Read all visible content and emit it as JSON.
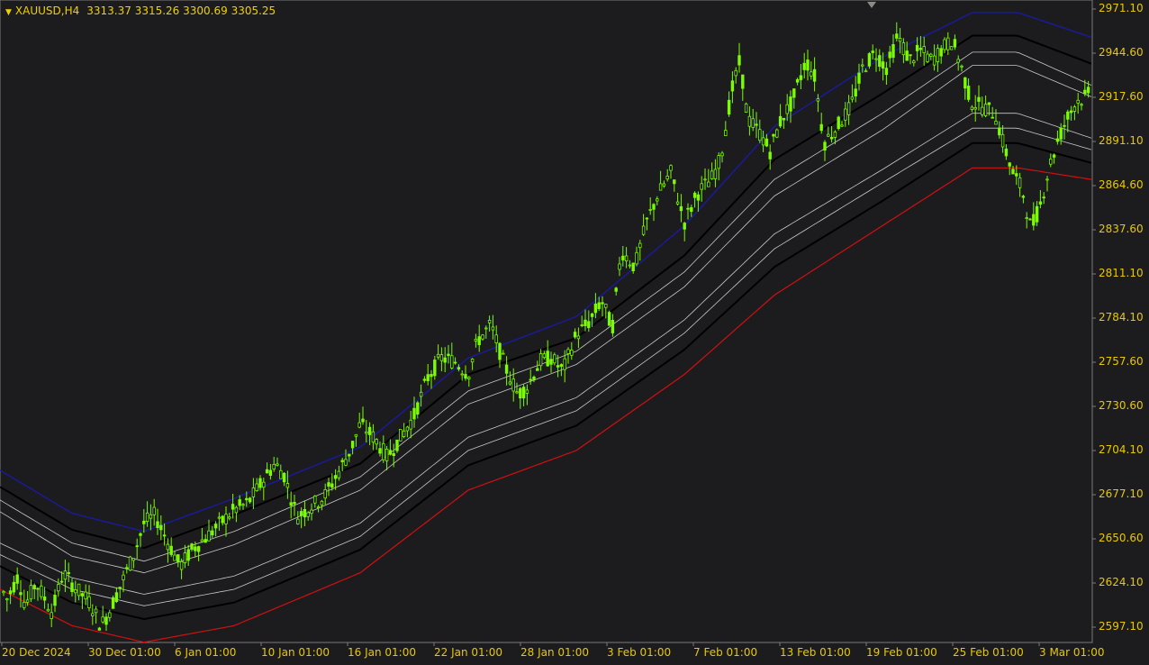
{
  "header": {
    "symbol": "XAUUSD,H4",
    "quote": "3313.37 3315.26 3300.69 3305.25"
  },
  "colors": {
    "background": "#1c1c1e",
    "axis": "#e8c800",
    "bull_candle": "#7cfc00",
    "upper_band": "#1a1aa0",
    "lower_band": "#d01010",
    "inner_dark": "#000000",
    "inner_light": "#c8c8c8"
  },
  "y_axis": {
    "ticks": [
      "2971.10",
      "2944.60",
      "2917.60",
      "2891.10",
      "2864.60",
      "2837.60",
      "2811.10",
      "2784.10",
      "2757.60",
      "2730.60",
      "2704.10",
      "2677.10",
      "2650.60",
      "2624.10",
      "2597.10"
    ]
  },
  "x_axis": {
    "ticks": [
      "20 Dec 2024",
      "30 Dec 01:00",
      "6 Jan 01:00",
      "10 Jan 01:00",
      "16 Jan 01:00",
      "22 Jan 01:00",
      "28 Jan 01:00",
      "3 Feb 01:00",
      "7 Feb 01:00",
      "13 Feb 01:00",
      "19 Feb 01:00",
      "25 Feb 01:00",
      "3 Mar 01:00"
    ]
  },
  "chart_data": {
    "type": "candlestick",
    "symbol": "XAUUSD",
    "timeframe": "H4",
    "ylim": [
      2590,
      2975
    ],
    "price_path": [
      [
        0,
        2622
      ],
      [
        8,
        2614
      ],
      [
        20,
        2628
      ],
      [
        28,
        2610
      ],
      [
        40,
        2624
      ],
      [
        58,
        2606
      ],
      [
        70,
        2630
      ],
      [
        85,
        2620
      ],
      [
        100,
        2612
      ],
      [
        112,
        2598
      ],
      [
        120,
        2605
      ],
      [
        132,
        2620
      ],
      [
        148,
        2640
      ],
      [
        160,
        2660
      ],
      [
        172,
        2665
      ],
      [
        185,
        2650
      ],
      [
        200,
        2634
      ],
      [
        215,
        2645
      ],
      [
        230,
        2652
      ],
      [
        245,
        2660
      ],
      [
        260,
        2668
      ],
      [
        275,
        2672
      ],
      [
        290,
        2684
      ],
      [
        305,
        2696
      ],
      [
        315,
        2690
      ],
      [
        330,
        2664
      ],
      [
        345,
        2670
      ],
      [
        360,
        2676
      ],
      [
        375,
        2690
      ],
      [
        390,
        2705
      ],
      [
        400,
        2720
      ],
      [
        415,
        2712
      ],
      [
        430,
        2700
      ],
      [
        445,
        2712
      ],
      [
        460,
        2725
      ],
      [
        475,
        2748
      ],
      [
        490,
        2760
      ],
      [
        505,
        2758
      ],
      [
        520,
        2750
      ],
      [
        530,
        2770
      ],
      [
        545,
        2780
      ],
      [
        560,
        2756
      ],
      [
        575,
        2738
      ],
      [
        585,
        2742
      ],
      [
        600,
        2758
      ],
      [
        612,
        2760
      ],
      [
        625,
        2752
      ],
      [
        640,
        2774
      ],
      [
        655,
        2782
      ],
      [
        668,
        2795
      ],
      [
        680,
        2778
      ],
      [
        690,
        2825
      ],
      [
        705,
        2815
      ],
      [
        718,
        2842
      ],
      [
        730,
        2858
      ],
      [
        745,
        2872
      ],
      [
        760,
        2842
      ],
      [
        775,
        2860
      ],
      [
        790,
        2868
      ],
      [
        800,
        2880
      ],
      [
        812,
        2920
      ],
      [
        822,
        2940
      ],
      [
        830,
        2905
      ],
      [
        845,
        2895
      ],
      [
        855,
        2885
      ],
      [
        868,
        2905
      ],
      [
        880,
        2915
      ],
      [
        895,
        2940
      ],
      [
        905,
        2930
      ],
      [
        915,
        2890
      ],
      [
        930,
        2900
      ],
      [
        945,
        2912
      ],
      [
        958,
        2935
      ],
      [
        972,
        2945
      ],
      [
        985,
        2935
      ],
      [
        997,
        2955
      ],
      [
        1010,
        2940
      ],
      [
        1022,
        2946
      ],
      [
        1035,
        2940
      ],
      [
        1048,
        2948
      ],
      [
        1058,
        2952
      ],
      [
        1068,
        2935
      ],
      [
        1078,
        2915
      ],
      [
        1090,
        2912
      ],
      [
        1105,
        2908
      ],
      [
        1115,
        2888
      ],
      [
        1125,
        2872
      ],
      [
        1135,
        2862
      ],
      [
        1145,
        2838
      ],
      [
        1155,
        2852
      ],
      [
        1165,
        2875
      ],
      [
        1175,
        2892
      ],
      [
        1185,
        2905
      ],
      [
        1195,
        2915
      ],
      [
        1212,
        2920
      ]
    ],
    "bands": {
      "upper": [
        [
          0,
          2692
        ],
        [
          80,
          2666
        ],
        [
          160,
          2655
        ],
        [
          260,
          2675
        ],
        [
          400,
          2706
        ],
        [
          520,
          2760
        ],
        [
          640,
          2785
        ],
        [
          760,
          2840
        ],
        [
          860,
          2900
        ],
        [
          980,
          2942
        ],
        [
          1080,
          2969
        ],
        [
          1130,
          2969
        ],
        [
          1212,
          2954
        ]
      ],
      "inner_top_dark": [
        [
          0,
          2682
        ],
        [
          80,
          2656
        ],
        [
          160,
          2645
        ],
        [
          260,
          2665
        ],
        [
          400,
          2696
        ],
        [
          520,
          2750
        ],
        [
          640,
          2772
        ],
        [
          760,
          2822
        ],
        [
          860,
          2880
        ],
        [
          980,
          2920
        ],
        [
          1080,
          2955
        ],
        [
          1130,
          2955
        ],
        [
          1212,
          2938
        ]
      ],
      "inner_top_light": [
        [
          0,
          2674
        ],
        [
          80,
          2648
        ],
        [
          160,
          2637
        ],
        [
          260,
          2655
        ],
        [
          400,
          2688
        ],
        [
          520,
          2740
        ],
        [
          640,
          2764
        ],
        [
          760,
          2812
        ],
        [
          860,
          2868
        ],
        [
          980,
          2908
        ],
        [
          1080,
          2945
        ],
        [
          1130,
          2945
        ],
        [
          1212,
          2925
        ]
      ],
      "inner_top_light2": [
        [
          0,
          2667
        ],
        [
          80,
          2640
        ],
        [
          160,
          2630
        ],
        [
          260,
          2647
        ],
        [
          400,
          2680
        ],
        [
          520,
          2732
        ],
        [
          640,
          2756
        ],
        [
          760,
          2803
        ],
        [
          860,
          2858
        ],
        [
          980,
          2898
        ],
        [
          1080,
          2937
        ],
        [
          1130,
          2937
        ],
        [
          1212,
          2918
        ]
      ],
      "inner_bot_light": [
        [
          0,
          2648
        ],
        [
          80,
          2627
        ],
        [
          160,
          2617
        ],
        [
          260,
          2628
        ],
        [
          400,
          2660
        ],
        [
          520,
          2712
        ],
        [
          640,
          2736
        ],
        [
          760,
          2783
        ],
        [
          860,
          2835
        ],
        [
          980,
          2874
        ],
        [
          1080,
          2908
        ],
        [
          1130,
          2908
        ],
        [
          1212,
          2893
        ]
      ],
      "inner_bot_light2": [
        [
          0,
          2641
        ],
        [
          80,
          2620
        ],
        [
          160,
          2610
        ],
        [
          260,
          2620
        ],
        [
          400,
          2652
        ],
        [
          520,
          2704
        ],
        [
          640,
          2728
        ],
        [
          760,
          2775
        ],
        [
          860,
          2826
        ],
        [
          980,
          2866
        ],
        [
          1080,
          2899
        ],
        [
          1130,
          2899
        ],
        [
          1212,
          2886
        ]
      ],
      "inner_bot_dark": [
        [
          0,
          2634
        ],
        [
          80,
          2612
        ],
        [
          160,
          2602
        ],
        [
          260,
          2612
        ],
        [
          400,
          2644
        ],
        [
          520,
          2695
        ],
        [
          640,
          2719
        ],
        [
          760,
          2765
        ],
        [
          860,
          2815
        ],
        [
          980,
          2855
        ],
        [
          1080,
          2890
        ],
        [
          1130,
          2890
        ],
        [
          1212,
          2878
        ]
      ],
      "lower": [
        [
          0,
          2620
        ],
        [
          80,
          2598
        ],
        [
          160,
          2588
        ],
        [
          260,
          2598
        ],
        [
          400,
          2630
        ],
        [
          520,
          2680
        ],
        [
          640,
          2704
        ],
        [
          760,
          2750
        ],
        [
          860,
          2798
        ],
        [
          980,
          2840
        ],
        [
          1080,
          2875
        ],
        [
          1130,
          2875
        ],
        [
          1212,
          2868
        ]
      ]
    }
  }
}
